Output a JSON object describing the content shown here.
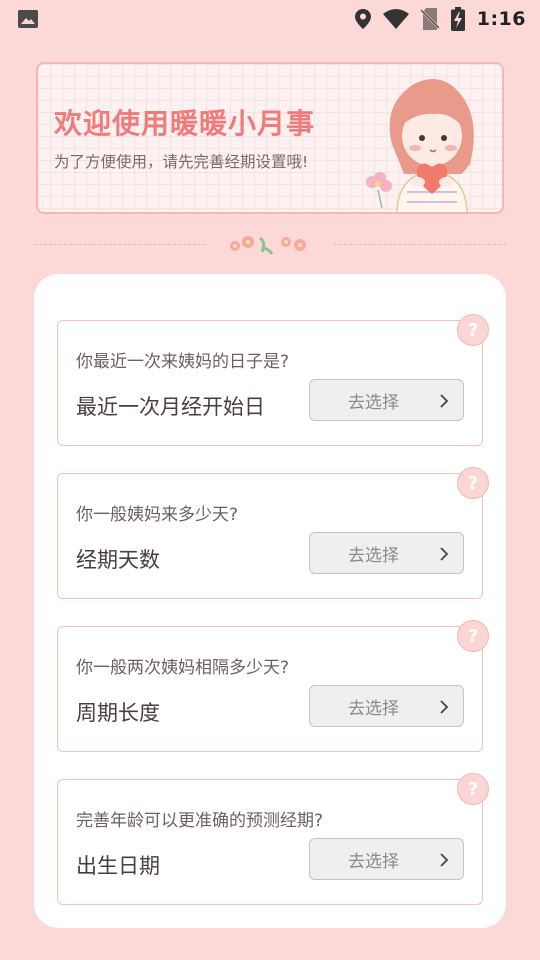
{
  "status_bar": {
    "time": "1:16",
    "icons": [
      "gallery-icon",
      "location-icon",
      "wifi-icon",
      "no-sim-icon",
      "battery-charging-icon"
    ]
  },
  "banner": {
    "title": "欢迎使用暖暖小月事",
    "subtitle": "为了方便使用，请先完善经期设置哦!"
  },
  "items": [
    {
      "question": "你最近一次来姨妈的日子是?",
      "label": "最近一次月经开始日",
      "button": "去选择",
      "help": "?"
    },
    {
      "question": "你一般姨妈来多少天?",
      "label": "经期天数",
      "button": "去选择",
      "help": "?"
    },
    {
      "question": "你一般两次姨妈相隔多少天?",
      "label": "周期长度",
      "button": "去选择",
      "help": "?"
    },
    {
      "question": "完善年龄可以更准确的预测经期?",
      "label": "出生日期",
      "button": "去选择",
      "help": "?"
    }
  ],
  "colors": {
    "background": "#fcd8d6",
    "accent": "#f07b7b",
    "card": "#ffffff",
    "border": "#f3c2c0"
  }
}
